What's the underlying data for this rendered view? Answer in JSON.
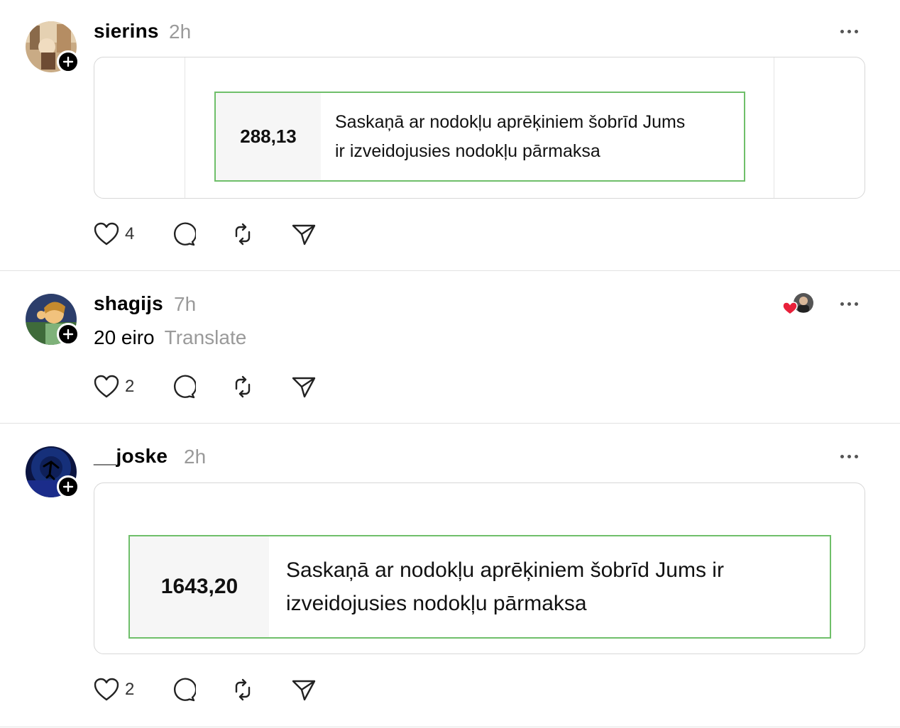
{
  "posts": [
    {
      "username": "sierins",
      "time": "2h",
      "tax_box": {
        "amount": "288,13",
        "line1": "Saskaņā ar nodokļu aprēķiniem šobrīd Jums",
        "line2": "ir izveidojusies nodokļu pārmaksa"
      },
      "actions": {
        "likes": "4"
      }
    },
    {
      "username": "shagijs",
      "time": "7h",
      "text": "20 eiro",
      "translate_label": "Translate",
      "actions": {
        "likes": "2"
      }
    },
    {
      "username": "__joske",
      "time": "2h",
      "tax_box": {
        "amount": "1643,20",
        "line1": "Saskaņā ar nodokļu aprēķiniem šobrīd Jums ir",
        "line2": "izveidojusies nodokļu pārmaksa"
      },
      "actions": {
        "likes": "2"
      }
    }
  ],
  "icons": {
    "like": "heart-icon",
    "reply": "comment-icon",
    "repost": "repost-icon",
    "share": "send-icon",
    "more": "more-icon",
    "follow": "plus-icon"
  },
  "colors": {
    "accent_green": "#6fbf6a",
    "liked_red": "#e8203a",
    "muted": "#9a9a9a"
  }
}
